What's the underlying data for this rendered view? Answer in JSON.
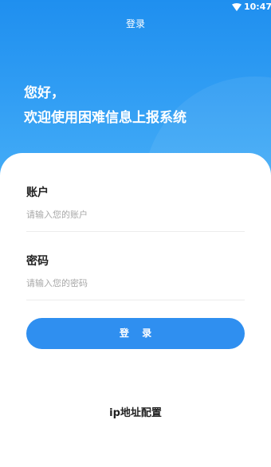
{
  "status_bar": {
    "time": "10:47",
    "wifi_icon": "wifi-icon"
  },
  "header": {
    "title": "登录"
  },
  "greeting": {
    "line1": "您好，",
    "line2": "欢迎使用困难信息上报系统"
  },
  "form": {
    "account": {
      "label": "账户",
      "placeholder": "请输入您的账户",
      "value": ""
    },
    "password": {
      "label": "密码",
      "placeholder": "请输入您的密码",
      "value": ""
    },
    "login_button": "登 录"
  },
  "footer": {
    "ip_config": "ip地址配置"
  },
  "colors": {
    "primary": "#2f8ff0",
    "hero_top": "#1f8fef",
    "hero_bottom": "#46aef7",
    "text_dark": "#222222",
    "placeholder": "#a8a8a8"
  }
}
